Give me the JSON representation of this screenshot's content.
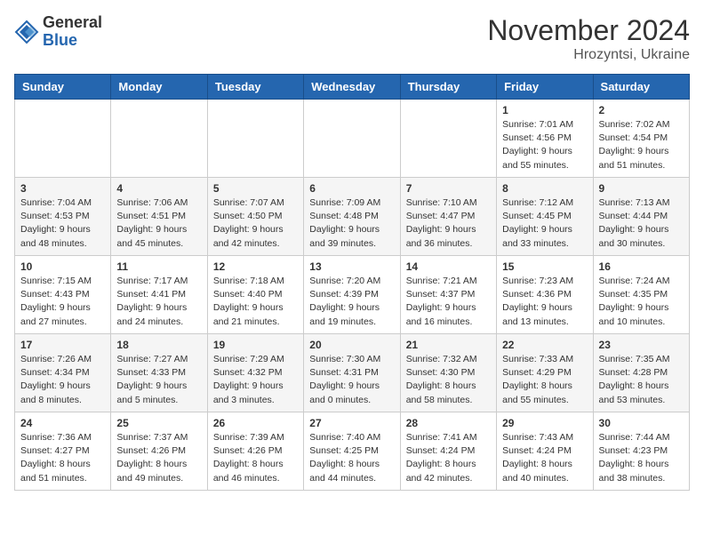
{
  "header": {
    "logo_general": "General",
    "logo_blue": "Blue",
    "month_title": "November 2024",
    "location": "Hrozyntsi, Ukraine"
  },
  "days_of_week": [
    "Sunday",
    "Monday",
    "Tuesday",
    "Wednesday",
    "Thursday",
    "Friday",
    "Saturday"
  ],
  "weeks": [
    [
      {
        "day": "",
        "info": ""
      },
      {
        "day": "",
        "info": ""
      },
      {
        "day": "",
        "info": ""
      },
      {
        "day": "",
        "info": ""
      },
      {
        "day": "",
        "info": ""
      },
      {
        "day": "1",
        "info": "Sunrise: 7:01 AM\nSunset: 4:56 PM\nDaylight: 9 hours and 55 minutes."
      },
      {
        "day": "2",
        "info": "Sunrise: 7:02 AM\nSunset: 4:54 PM\nDaylight: 9 hours and 51 minutes."
      }
    ],
    [
      {
        "day": "3",
        "info": "Sunrise: 7:04 AM\nSunset: 4:53 PM\nDaylight: 9 hours and 48 minutes."
      },
      {
        "day": "4",
        "info": "Sunrise: 7:06 AM\nSunset: 4:51 PM\nDaylight: 9 hours and 45 minutes."
      },
      {
        "day": "5",
        "info": "Sunrise: 7:07 AM\nSunset: 4:50 PM\nDaylight: 9 hours and 42 minutes."
      },
      {
        "day": "6",
        "info": "Sunrise: 7:09 AM\nSunset: 4:48 PM\nDaylight: 9 hours and 39 minutes."
      },
      {
        "day": "7",
        "info": "Sunrise: 7:10 AM\nSunset: 4:47 PM\nDaylight: 9 hours and 36 minutes."
      },
      {
        "day": "8",
        "info": "Sunrise: 7:12 AM\nSunset: 4:45 PM\nDaylight: 9 hours and 33 minutes."
      },
      {
        "day": "9",
        "info": "Sunrise: 7:13 AM\nSunset: 4:44 PM\nDaylight: 9 hours and 30 minutes."
      }
    ],
    [
      {
        "day": "10",
        "info": "Sunrise: 7:15 AM\nSunset: 4:43 PM\nDaylight: 9 hours and 27 minutes."
      },
      {
        "day": "11",
        "info": "Sunrise: 7:17 AM\nSunset: 4:41 PM\nDaylight: 9 hours and 24 minutes."
      },
      {
        "day": "12",
        "info": "Sunrise: 7:18 AM\nSunset: 4:40 PM\nDaylight: 9 hours and 21 minutes."
      },
      {
        "day": "13",
        "info": "Sunrise: 7:20 AM\nSunset: 4:39 PM\nDaylight: 9 hours and 19 minutes."
      },
      {
        "day": "14",
        "info": "Sunrise: 7:21 AM\nSunset: 4:37 PM\nDaylight: 9 hours and 16 minutes."
      },
      {
        "day": "15",
        "info": "Sunrise: 7:23 AM\nSunset: 4:36 PM\nDaylight: 9 hours and 13 minutes."
      },
      {
        "day": "16",
        "info": "Sunrise: 7:24 AM\nSunset: 4:35 PM\nDaylight: 9 hours and 10 minutes."
      }
    ],
    [
      {
        "day": "17",
        "info": "Sunrise: 7:26 AM\nSunset: 4:34 PM\nDaylight: 9 hours and 8 minutes."
      },
      {
        "day": "18",
        "info": "Sunrise: 7:27 AM\nSunset: 4:33 PM\nDaylight: 9 hours and 5 minutes."
      },
      {
        "day": "19",
        "info": "Sunrise: 7:29 AM\nSunset: 4:32 PM\nDaylight: 9 hours and 3 minutes."
      },
      {
        "day": "20",
        "info": "Sunrise: 7:30 AM\nSunset: 4:31 PM\nDaylight: 9 hours and 0 minutes."
      },
      {
        "day": "21",
        "info": "Sunrise: 7:32 AM\nSunset: 4:30 PM\nDaylight: 8 hours and 58 minutes."
      },
      {
        "day": "22",
        "info": "Sunrise: 7:33 AM\nSunset: 4:29 PM\nDaylight: 8 hours and 55 minutes."
      },
      {
        "day": "23",
        "info": "Sunrise: 7:35 AM\nSunset: 4:28 PM\nDaylight: 8 hours and 53 minutes."
      }
    ],
    [
      {
        "day": "24",
        "info": "Sunrise: 7:36 AM\nSunset: 4:27 PM\nDaylight: 8 hours and 51 minutes."
      },
      {
        "day": "25",
        "info": "Sunrise: 7:37 AM\nSunset: 4:26 PM\nDaylight: 8 hours and 49 minutes."
      },
      {
        "day": "26",
        "info": "Sunrise: 7:39 AM\nSunset: 4:26 PM\nDaylight: 8 hours and 46 minutes."
      },
      {
        "day": "27",
        "info": "Sunrise: 7:40 AM\nSunset: 4:25 PM\nDaylight: 8 hours and 44 minutes."
      },
      {
        "day": "28",
        "info": "Sunrise: 7:41 AM\nSunset: 4:24 PM\nDaylight: 8 hours and 42 minutes."
      },
      {
        "day": "29",
        "info": "Sunrise: 7:43 AM\nSunset: 4:24 PM\nDaylight: 8 hours and 40 minutes."
      },
      {
        "day": "30",
        "info": "Sunrise: 7:44 AM\nSunset: 4:23 PM\nDaylight: 8 hours and 38 minutes."
      }
    ]
  ]
}
